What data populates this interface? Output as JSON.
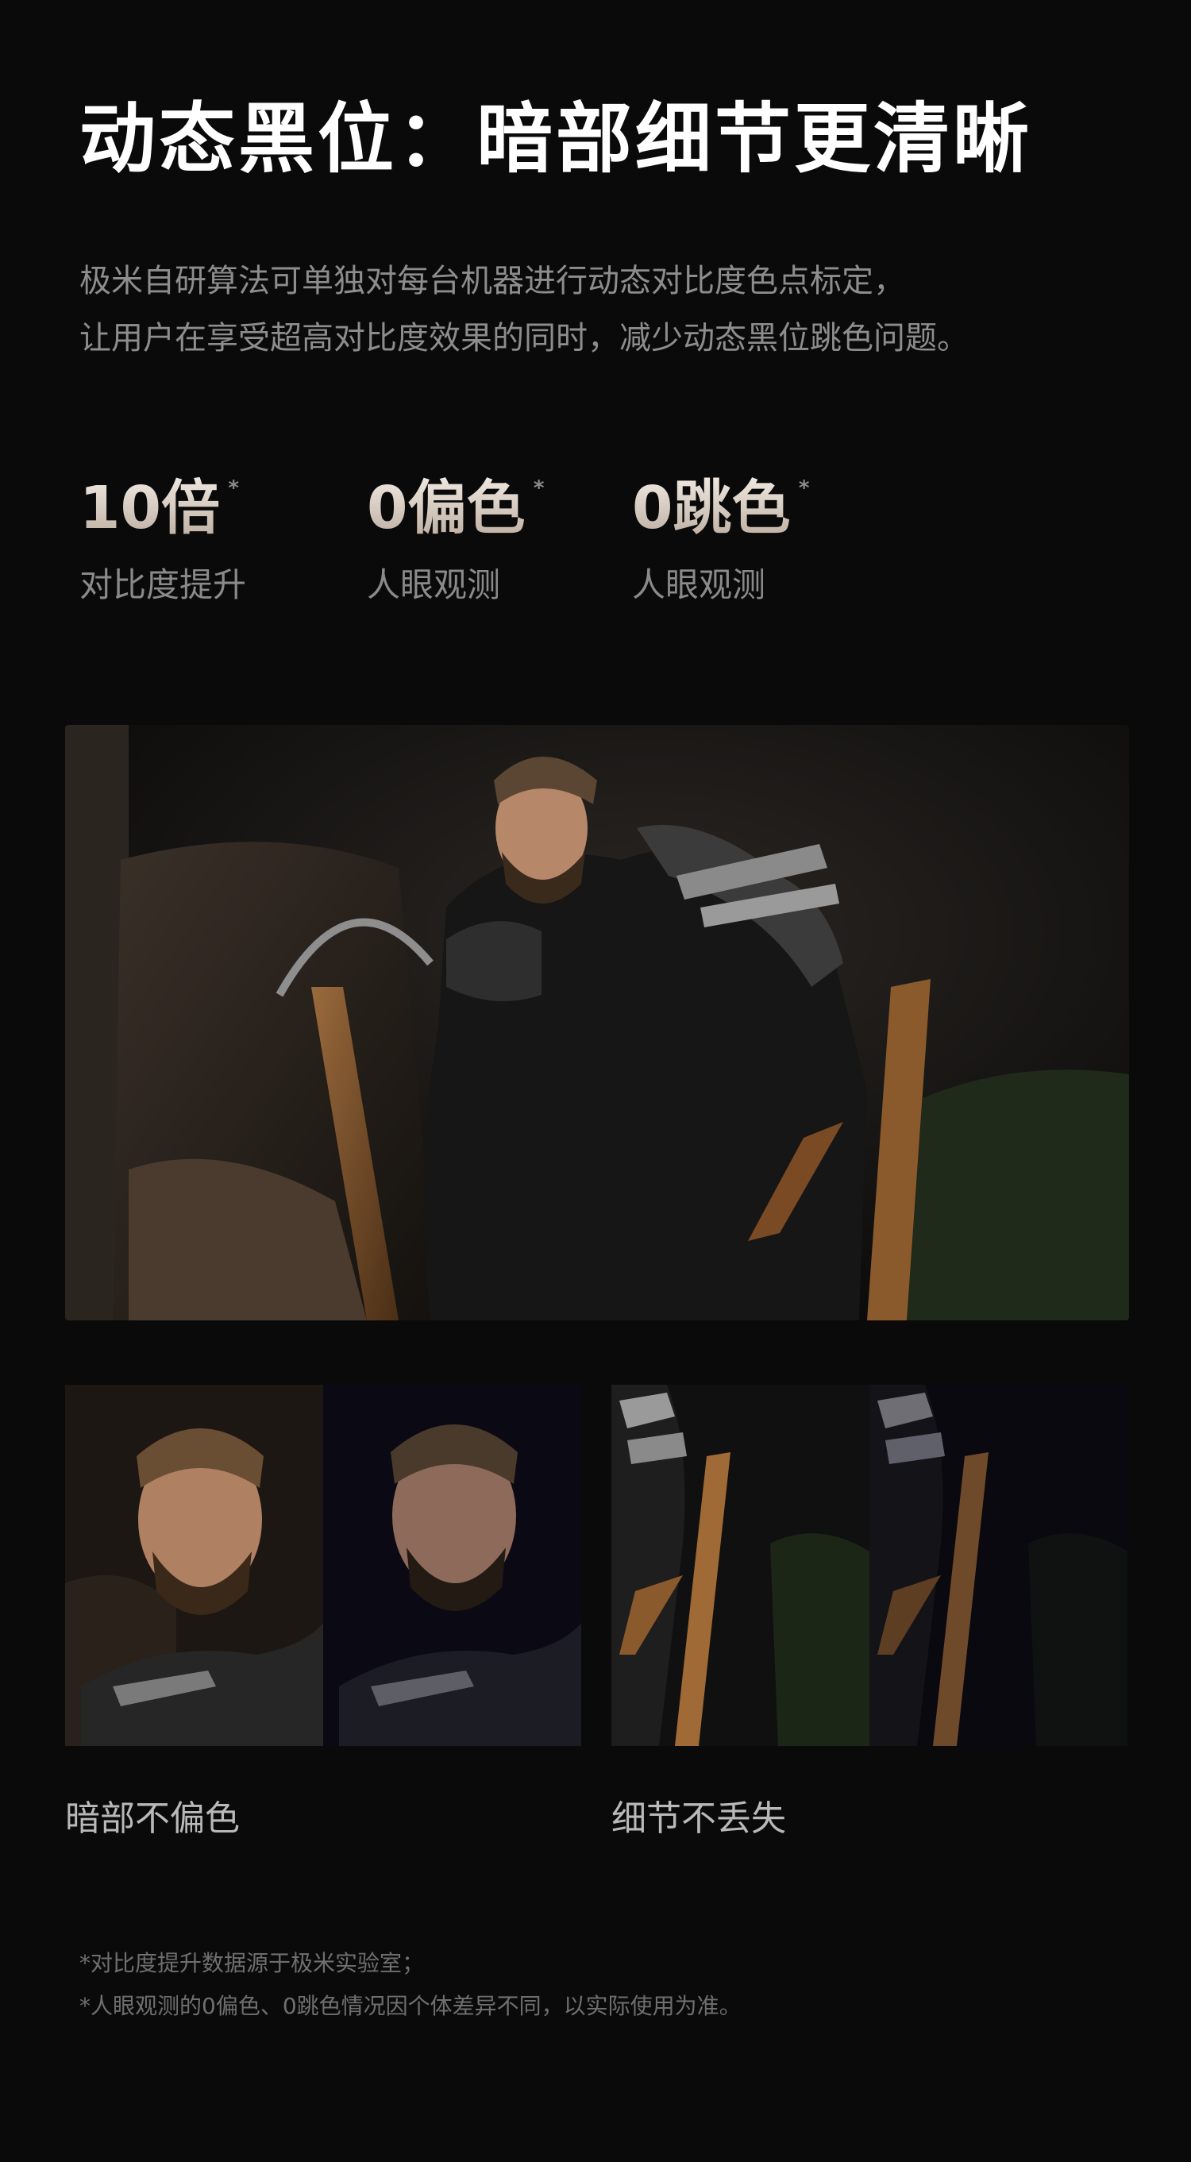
{
  "title": "动态黑位：暗部细节更清晰",
  "description": [
    "极米自研算法可单独对每台机器进行动态对比度色点标定，",
    "让用户在享受超高对比度效果的同时，减少动态黑位跳色问题。"
  ],
  "stats": [
    {
      "value": "10倍",
      "mark": "*",
      "label": "对比度提升"
    },
    {
      "value": "0偏色",
      "mark": "*",
      "label": "人眼观测"
    },
    {
      "value": "0跳色",
      "mark": "*",
      "label": "人眼观测"
    }
  ],
  "captions": {
    "left": "暗部不偏色",
    "right": "细节不丢失"
  },
  "notes": [
    "*对比度提升数据源于极米实验室；",
    "*人眼观测的0偏色、0跳色情况因个体差异不同，以实际使用为准。"
  ]
}
